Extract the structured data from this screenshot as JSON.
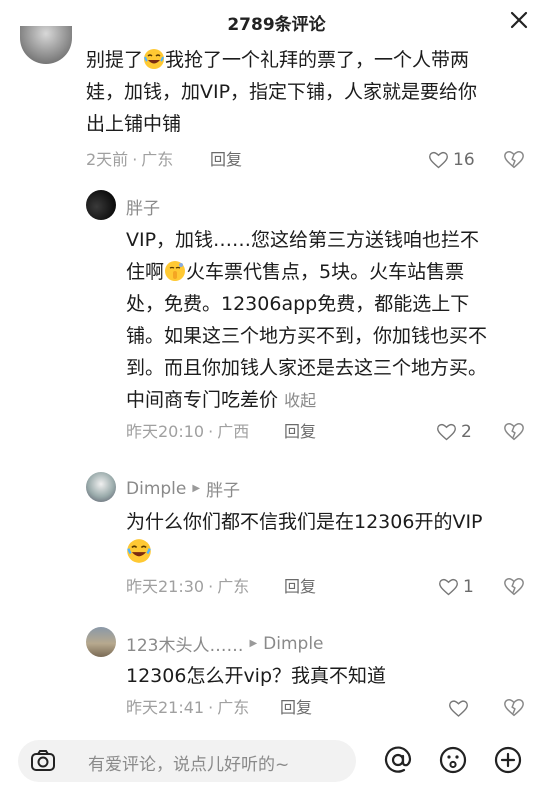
{
  "header": {
    "title": "2789条评论"
  },
  "comment1": {
    "text_lines": [
      "别提了",
      "我抢了一个礼拜的票了，一个人带两",
      "娃，加钱，加VIP，指定下铺，人家就是要给你",
      "出上铺中铺"
    ],
    "time": "2天前",
    "location": "广东",
    "reply": "回复",
    "likes": "16"
  },
  "comment2": {
    "name": "胖子",
    "lines": [
      "VIP，加钱……您这给第三方送钱咱也拦不",
      "住啊",
      "火车票代售点，5块。火车站售票",
      "处，免费。12306app免费，都能选上下",
      "铺。如果这三个地方买不到，你加钱也买不",
      "到。而且你加钱人家还是去这三个地方买。",
      "中间商专门吃差价"
    ],
    "collapse": "收起",
    "time": "昨天20:10",
    "location": "广西",
    "reply": "回复",
    "likes": "2"
  },
  "comment3": {
    "name": "Dimple",
    "reply_to": "胖子",
    "line1": "为什么你们都不信我们是在12306开的VIP",
    "time": "昨天21:30",
    "location": "广东",
    "reply": "回复",
    "likes": "1"
  },
  "comment4": {
    "name": "123木头人……",
    "reply_to": "Dimple",
    "line1": "12306怎么开vip？我真不知道",
    "time": "昨天21:41",
    "location": "广东",
    "reply": "回复"
  },
  "input": {
    "placeholder": "有爱评论，说点儿好听的~"
  },
  "icons": [
    "close-icon",
    "camera-icon",
    "at-icon",
    "emoji-icon",
    "plus-icon",
    "heart-icon",
    "dislike-icon"
  ]
}
